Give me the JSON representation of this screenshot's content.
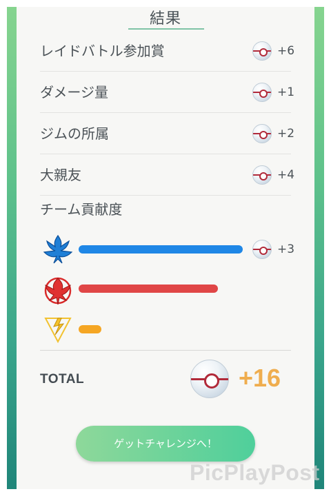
{
  "header": {
    "title": "結果"
  },
  "rewards": [
    {
      "label": "レイドバトル参加賞",
      "amount": "+6",
      "icon": "premier-ball-icon"
    },
    {
      "label": "ダメージ量",
      "amount": "+1",
      "icon": "premier-ball-icon"
    },
    {
      "label": "ジムの所属",
      "amount": "+2",
      "icon": "premier-ball-icon"
    },
    {
      "label": "大親友",
      "amount": "+4",
      "icon": "premier-ball-icon"
    }
  ],
  "team_contribution": {
    "title": "チーム貢献度",
    "teams": [
      {
        "name": "mystic",
        "icon": "team-mystic-icon",
        "color": "#1f87e6",
        "contribution": 1.0,
        "amount": "+3"
      },
      {
        "name": "valor",
        "icon": "team-valor-icon",
        "color": "#e04646",
        "contribution": 0.85
      },
      {
        "name": "instinct",
        "icon": "team-instinct-icon",
        "color": "#f5a623",
        "contribution": 0.14
      }
    ]
  },
  "total": {
    "label": "TOTAL",
    "value": "+16",
    "icon": "premier-ball-icon"
  },
  "cta": {
    "label": "ゲットチャレンジへ！"
  },
  "watermark": "PicPlayPost",
  "colors": {
    "accent_green": "#4fcf9b",
    "total_orange": "#efad4e"
  }
}
